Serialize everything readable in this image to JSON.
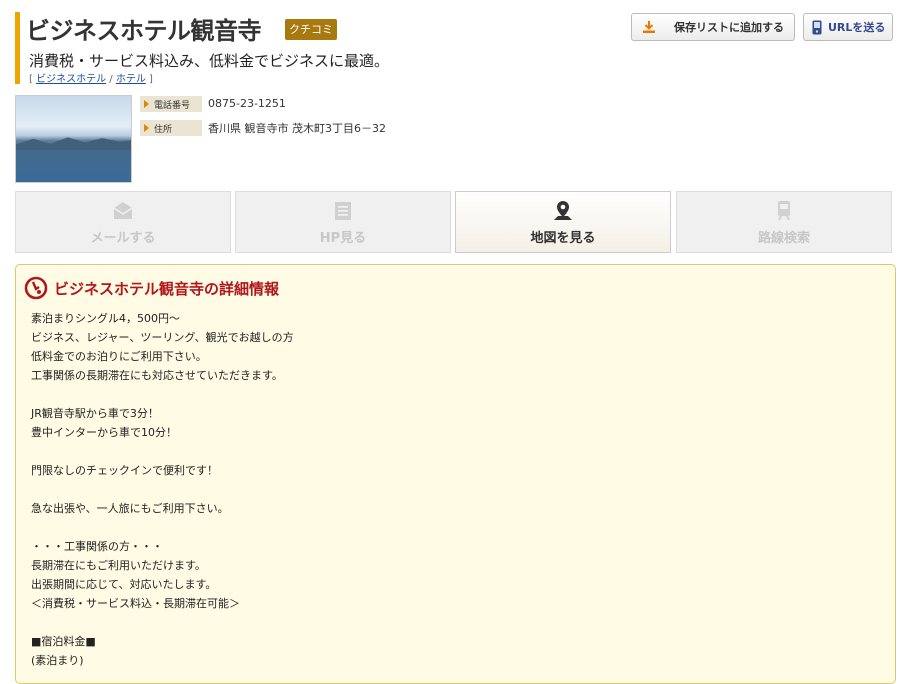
{
  "header": {
    "title": "ビジネスホテル観音寺",
    "kuchikomi": "クチコミ",
    "subtitle": "消費税・サービス料込み、低料金でビジネスに最適。",
    "breadcrumb": {
      "open": "[",
      "cat1": "ビジネスホテル",
      "sep": "/",
      "cat2": "ホテル",
      "close": "]"
    }
  },
  "toolbar": {
    "save_label": "保存リストに追加する",
    "url_label": "URLを送る"
  },
  "info": {
    "phone_label": "電話番号",
    "phone": "0875-23-1251",
    "address_label": "住所",
    "address": "香川県 観音寺市 茂木町3丁目6－32"
  },
  "actions": {
    "mail": "メールする",
    "hp": "HP見る",
    "map": "地図を見る",
    "route": "路線検索"
  },
  "detail": {
    "title": "ビジネスホテル観音寺の詳細情報",
    "lines": [
      "素泊まりシングル4，500円～",
      "ビジネス、レジャー、ツーリング、観光でお越しの方",
      "低料金でのお泊りにご利用下さい。",
      "工事関係の長期滞在にも対応させていただきます。",
      "",
      "JR観音寺駅から車で3分！",
      "豊中インターから車で10分！",
      "",
      "門限なしのチェックインで便利です！",
      "",
      "急な出張や、一人旅にもご利用下さい。",
      "",
      "・・・工事関係の方・・・",
      "長期滞在にもご利用いただけます。",
      "出張期間に応じて、対応いたします。",
      "＜消費税・サービス料込・長期滞在可能＞",
      "",
      "■宿泊料金■",
      "(素泊まり)"
    ]
  },
  "colors": {
    "accent": "#f0a400",
    "title_red": "#b0161a",
    "panel_bg": "#fffbe4",
    "badge": "#a8790f"
  }
}
